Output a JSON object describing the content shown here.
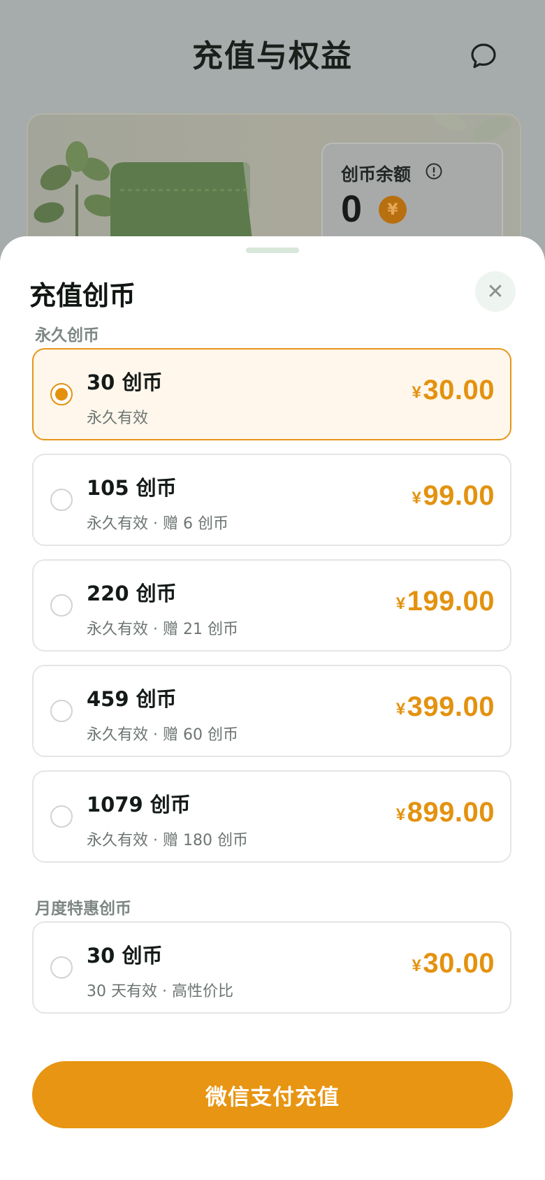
{
  "header": {
    "title": "充值与权益",
    "chat_icon": "chat-bubble-icon"
  },
  "balance_card": {
    "label": "创币余额",
    "info_icon": "info-icon",
    "value": "0",
    "coin_icon": "yuan-coin-icon",
    "coin_symbol": "¥"
  },
  "sheet": {
    "title": "充值创币",
    "close_icon": "close-icon",
    "close_glyph": "✕",
    "sections": [
      {
        "label": "永久创币"
      },
      {
        "label": "月度特惠创币"
      }
    ],
    "options": [
      {
        "title": "30 创币",
        "subtitle": "永久有效",
        "currency": "¥",
        "price": "30.00",
        "selected": true
      },
      {
        "title": "105 创币",
        "subtitle": "永久有效 · 赠 6 创币",
        "currency": "¥",
        "price": "99.00",
        "selected": false
      },
      {
        "title": "220 创币",
        "subtitle": "永久有效 · 赠 21 创币",
        "currency": "¥",
        "price": "199.00",
        "selected": false
      },
      {
        "title": "459 创币",
        "subtitle": "永久有效 · 赠 60 创币",
        "currency": "¥",
        "price": "399.00",
        "selected": false
      },
      {
        "title": "1079 创币",
        "subtitle": "永久有效 · 赠 180 创币",
        "currency": "¥",
        "price": "899.00",
        "selected": false
      },
      {
        "title": "30 创币",
        "subtitle": "30 天有效 · 高性价比",
        "currency": "¥",
        "price": "30.00",
        "selected": false
      }
    ],
    "pay_button": "微信支付充值"
  },
  "colors": {
    "accent": "#e79512",
    "selected_bg": "#fff7ec",
    "handle": "#d7e7d9"
  }
}
